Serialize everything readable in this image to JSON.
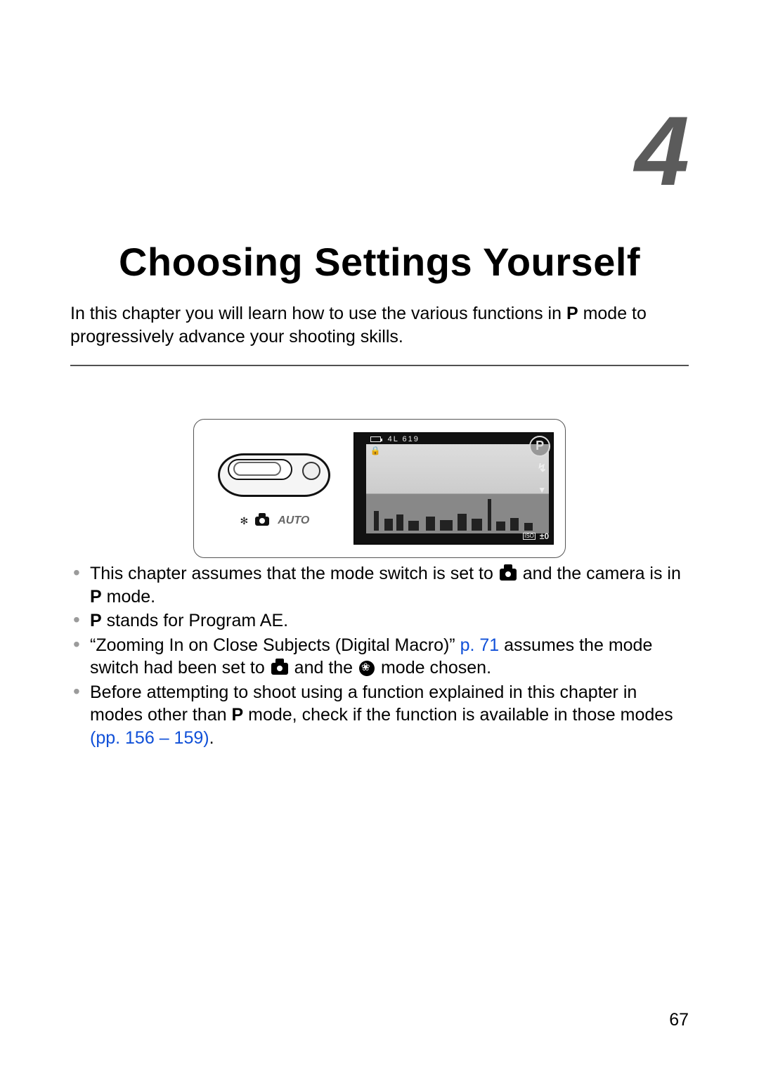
{
  "chapter": {
    "number": "4",
    "title": "Choosing Settings Yourself",
    "intro_a": "In this chapter you will learn how to use the various functions in ",
    "intro_b": " mode to progressively advance your shooting skills."
  },
  "lcd": {
    "mode_badge": "P",
    "iso_label": "ISO",
    "ev_value": "±0",
    "top_text": "4L 619",
    "flash": "↯",
    "arrow": "▼",
    "auto_label": "AUTO"
  },
  "bullets": {
    "b1_a": "This chapter assumes that the mode switch is set to ",
    "b1_b": " and the camera is in ",
    "b1_c": " mode.",
    "b2_a": " stands for Program AE.",
    "b3_a": "“Zooming In on Close Subjects (Digital Macro)” ",
    "b3_link": "p. 71",
    "b3_b": " assumes the mode switch had been set to ",
    "b3_c": " and the ",
    "b3_d": " mode chosen.",
    "b4_a": "Before attempting to shoot using a function explained in this chapter in modes other than ",
    "b4_b": " mode, check if the function is available in those modes ",
    "b4_ppopen": "(pp. ",
    "b4_link1": "156",
    "b4_dash": " – ",
    "b4_link2": "159",
    "b4_ppclose": ")",
    "b4_period": "."
  },
  "page_number": "67"
}
